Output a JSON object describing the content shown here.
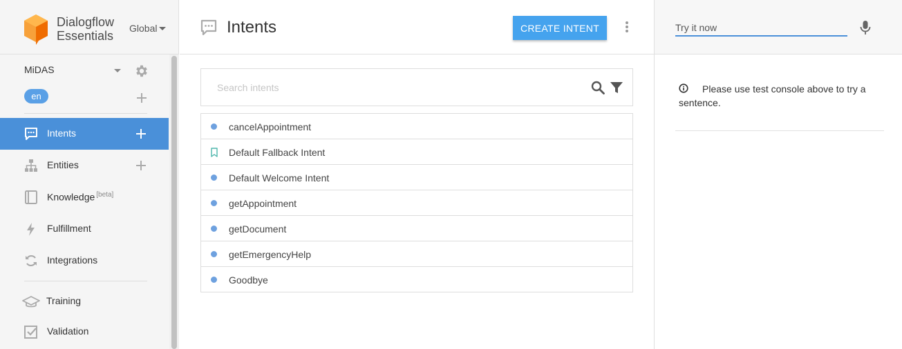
{
  "brand": {
    "name": "Dialogflow Essentials",
    "region": "Global"
  },
  "agent": {
    "name": "MiDAS",
    "language": "en"
  },
  "sidebar": {
    "items": [
      {
        "label": "Intents",
        "icon": "chat-bubble-icon",
        "active": true
      },
      {
        "label": "Entities",
        "icon": "hierarchy-icon"
      },
      {
        "label": "Knowledge",
        "badge": "[beta]",
        "icon": "book-icon"
      },
      {
        "label": "Fulfillment",
        "icon": "lightning-icon"
      },
      {
        "label": "Integrations",
        "icon": "sync-icon"
      },
      {
        "label": "Training",
        "icon": "graduation-cap-icon"
      },
      {
        "label": "Validation",
        "icon": "checkbox-icon"
      }
    ]
  },
  "main": {
    "title": "Intents",
    "create_button": "CREATE INTENT",
    "search_placeholder": "Search intents",
    "intents": [
      {
        "name": "cancelAppointment",
        "marker": "dot"
      },
      {
        "name": "Default Fallback Intent",
        "marker": "bookmark"
      },
      {
        "name": "Default Welcome Intent",
        "marker": "dot"
      },
      {
        "name": "getAppointment",
        "marker": "dot"
      },
      {
        "name": "getDocument",
        "marker": "dot"
      },
      {
        "name": "getEmergencyHelp",
        "marker": "dot"
      },
      {
        "name": "Goodbye",
        "marker": "dot"
      }
    ]
  },
  "test_console": {
    "placeholder": "Try it now",
    "info": "Please use test console above to try a sentence."
  },
  "colors": {
    "accent": "#4a90d9",
    "button": "#45a3ee",
    "logo": "#f57c00",
    "dot": "#6ea1df",
    "bookmark": "#4db6ac"
  }
}
